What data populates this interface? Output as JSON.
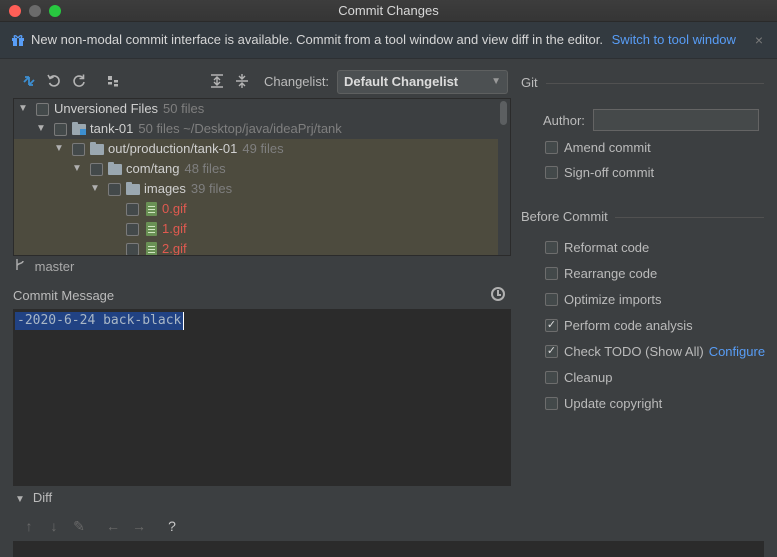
{
  "window": {
    "title": "Commit Changes"
  },
  "banner": {
    "message": "New non-modal commit interface is available. Commit from a tool window and view diff in the editor.",
    "link": "Switch to tool window",
    "close": "×"
  },
  "toolbar": {
    "changelist_label": "Changelist:",
    "changelist_value": "Default Changelist"
  },
  "tree": {
    "rows": [
      {
        "name": "Unversioned Files",
        "count": "50 files"
      },
      {
        "name": "tank-01",
        "count": "50 files  ~/Desktop/java/ideaPrj/tank"
      },
      {
        "name": "out/production/tank-01",
        "count": "49 files"
      },
      {
        "name": "com/tang",
        "count": "48 files"
      },
      {
        "name": "images",
        "count": "39 files"
      },
      {
        "name": "0.gif"
      },
      {
        "name": "1.gif"
      },
      {
        "name": "2.gif"
      }
    ]
  },
  "branch": {
    "name": "master"
  },
  "commit": {
    "label": "Commit Message",
    "message": "-2020-6-24 back-black"
  },
  "diff": {
    "label": "Diff",
    "help": "?"
  },
  "git": {
    "title": "Git",
    "author_label": "Author:",
    "author_value": "",
    "options": [
      {
        "label": "Amend commit",
        "checked": false
      },
      {
        "label": "Sign-off commit",
        "checked": false
      }
    ]
  },
  "before_commit": {
    "title": "Before Commit",
    "options": [
      {
        "label": "Reformat code",
        "checked": false
      },
      {
        "label": "Rearrange code",
        "checked": false
      },
      {
        "label": "Optimize imports",
        "checked": false
      },
      {
        "label": "Perform code analysis",
        "checked": true
      },
      {
        "label": "Check TODO (Show All)",
        "checked": true,
        "link": "Configure"
      },
      {
        "label": "Cleanup",
        "checked": false
      },
      {
        "label": "Update copyright",
        "checked": false
      }
    ]
  },
  "colors": {
    "accent_link": "#589df6",
    "selection": "#214283",
    "modified_file": "#e05a50",
    "highlight_row": "#4d4b3e"
  }
}
